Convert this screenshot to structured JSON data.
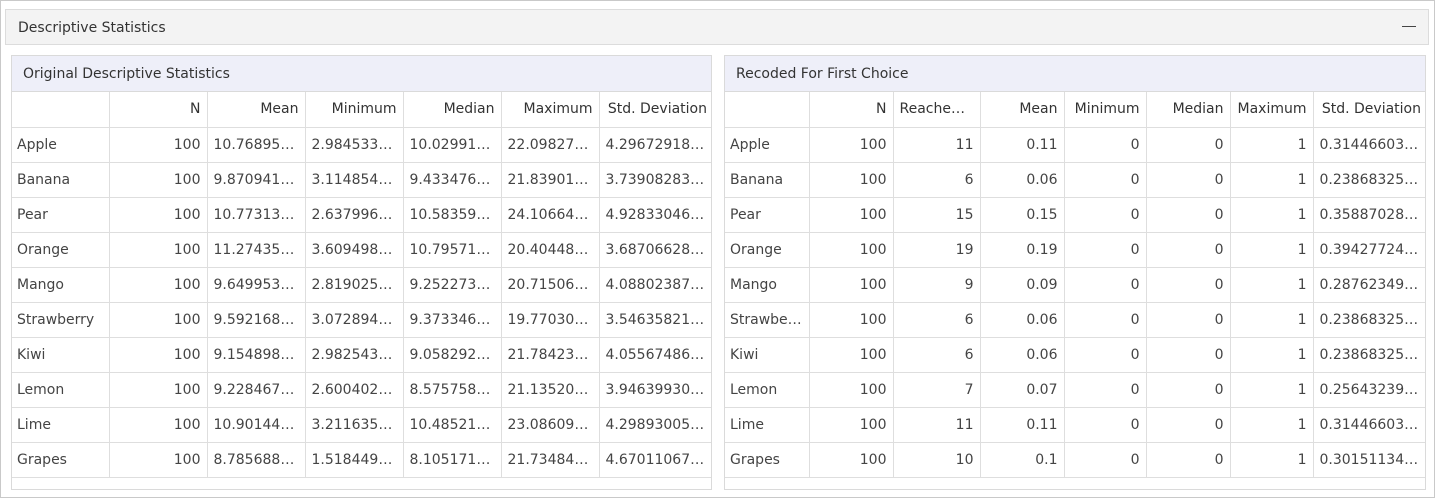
{
  "panel": {
    "title": "Descriptive Statistics"
  },
  "left_table": {
    "title": "Original Descriptive Statistics",
    "columns": [
      "",
      "N",
      "Mean",
      "Minimum",
      "Median",
      "Maximum",
      "Std. Deviation"
    ],
    "rows": [
      [
        "Apple",
        "100",
        "10.768953…",
        "2.9845336…",
        "10.029913…",
        "22.098276…",
        "4.296729186…"
      ],
      [
        "Banana",
        "100",
        "9.8709414…",
        "3.1148548…",
        "9.4334760…",
        "21.839013…",
        "3.739082839…"
      ],
      [
        "Pear",
        "100",
        "10.773138…",
        "2.6379964…",
        "10.583591…",
        "24.106648…",
        "4.928330460…"
      ],
      [
        "Orange",
        "100",
        "11.274350…",
        "3.6094984…",
        "10.795710…",
        "20.404487…",
        "3.687066281…"
      ],
      [
        "Mango",
        "100",
        "9.6499533…",
        "2.8190257…",
        "9.2522735…",
        "20.715065…",
        "4.088023870…"
      ],
      [
        "Strawberry",
        "100",
        "9.5921684…",
        "3.0728943…",
        "9.3733467…",
        "19.770308…",
        "3.546358210…"
      ],
      [
        "Kiwi",
        "100",
        "9.1548980…",
        "2.9825432…",
        "9.0582920…",
        "21.784231…",
        "4.055674867…"
      ],
      [
        "Lemon",
        "100",
        "9.2284671…",
        "2.6004025…",
        "8.5757583…",
        "21.135201…",
        "3.946399304…"
      ],
      [
        "Lime",
        "100",
        "10.901440…",
        "3.2116358…",
        "10.485217…",
        "23.086099…",
        "4.298930055…"
      ],
      [
        "Grapes",
        "100",
        "8.7856883…",
        "1.5184492…",
        "8.1051711…",
        "21.734843…",
        "4.670110674…"
      ]
    ]
  },
  "right_table": {
    "title": "Recoded For First Choice",
    "columns": [
      "",
      "N",
      "Reached N",
      "Mean",
      "Minimum",
      "Median",
      "Maximum",
      "Std. Deviation"
    ],
    "rows": [
      [
        "Apple",
        "100",
        "11",
        "0.11",
        "0",
        "0",
        "1",
        "0.314466037…"
      ],
      [
        "Banana",
        "100",
        "6",
        "0.06",
        "0",
        "0",
        "1",
        "0.238683256…"
      ],
      [
        "Pear",
        "100",
        "15",
        "0.15",
        "0",
        "0",
        "1",
        "0.358870281…"
      ],
      [
        "Orange",
        "100",
        "19",
        "0.19",
        "0",
        "0",
        "1",
        "0.394277244…"
      ],
      [
        "Mango",
        "100",
        "9",
        "0.09",
        "0",
        "0",
        "1",
        "0.287623491…"
      ],
      [
        "Strawbe…",
        "100",
        "6",
        "0.06",
        "0",
        "0",
        "1",
        "0.238683256…"
      ],
      [
        "Kiwi",
        "100",
        "6",
        "0.06",
        "0",
        "0",
        "1",
        "0.238683256…"
      ],
      [
        "Lemon",
        "100",
        "7",
        "0.07",
        "0",
        "0",
        "1",
        "0.256432399…"
      ],
      [
        "Lime",
        "100",
        "11",
        "0.11",
        "0",
        "0",
        "1",
        "0.314466037…"
      ],
      [
        "Grapes",
        "100",
        "10",
        "0.1",
        "0",
        "0",
        "1",
        "0.301511344…"
      ]
    ]
  },
  "colors": {
    "table_title_bg": "#eeeff9",
    "panel_header_bg": "#f3f3f3",
    "border": "#dadada"
  }
}
